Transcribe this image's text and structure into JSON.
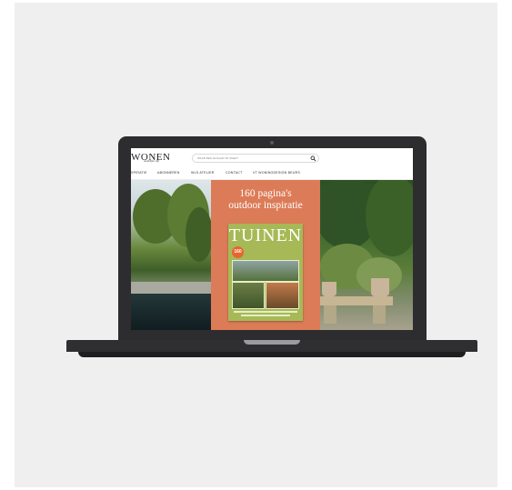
{
  "site": {
    "logo": "WONEN",
    "logo_tagline": "landelijke stijl",
    "search_placeholder": "WAAR BEN JE NAAR OP ZOEK?"
  },
  "nav": {
    "items": [
      "SPIRATIE",
      "ABONNEREN",
      "WLS ATELIER",
      "CONTACT",
      "VT WONINGDESIGN BEURS"
    ]
  },
  "hero": {
    "headline_line1": "160 pagina's",
    "headline_line2": "outdoor inspiratie"
  },
  "magazine": {
    "title": "TUINEN",
    "badge": "160"
  },
  "colors": {
    "promo_orange": "#dc7b57",
    "magazine_green": "#a6b956",
    "laptop": "#2d2d2f",
    "background": "#efeff0"
  }
}
